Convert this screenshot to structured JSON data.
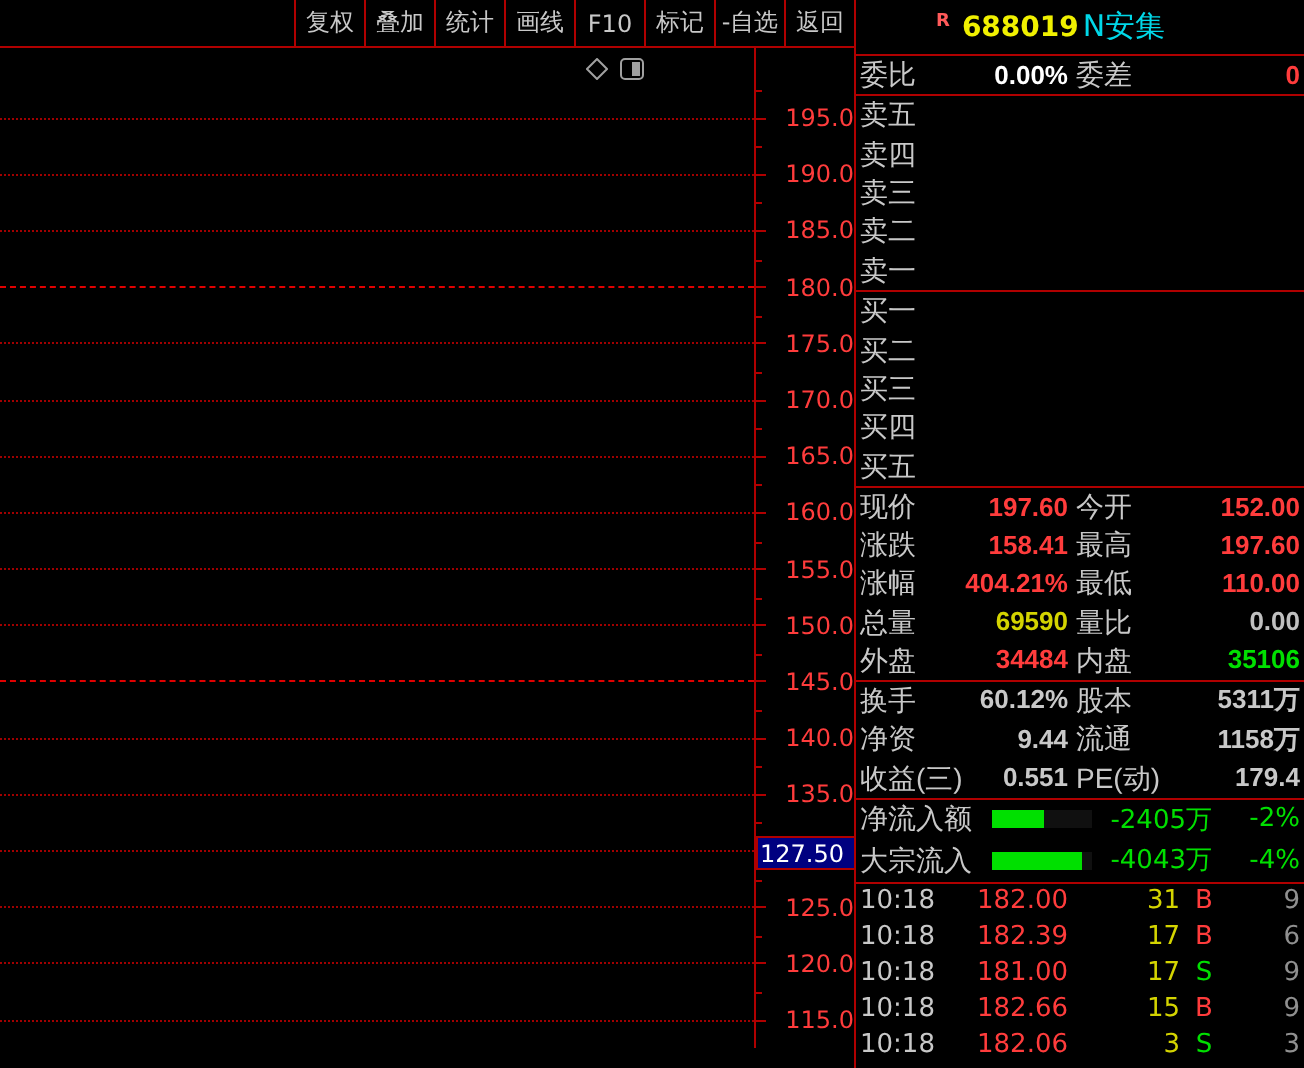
{
  "toolbar": {
    "buttons": [
      "复权",
      "叠加",
      "统计",
      "画线",
      "F10",
      "标记",
      "-自选",
      "返回"
    ]
  },
  "axis": [
    {
      "kind": "tick",
      "label": "195.0"
    },
    {
      "kind": "tick",
      "label": "190.0"
    },
    {
      "kind": "tick",
      "label": "185.0"
    },
    {
      "kind": "major",
      "label": "180.0"
    },
    {
      "kind": "tick",
      "label": "175.0"
    },
    {
      "kind": "tick",
      "label": "170.0"
    },
    {
      "kind": "tick",
      "label": "165.0"
    },
    {
      "kind": "tick",
      "label": "160.0"
    },
    {
      "kind": "tick",
      "label": "155.0"
    },
    {
      "kind": "tick",
      "label": "150.0"
    },
    {
      "kind": "major",
      "label": "145.0"
    },
    {
      "kind": "tick",
      "label": "140.0"
    },
    {
      "kind": "tick",
      "label": "135.0"
    },
    {
      "kind": "cursor",
      "label": "127.50"
    },
    {
      "kind": "tick",
      "label": "125.0"
    },
    {
      "kind": "tick",
      "label": "120.0"
    },
    {
      "kind": "tick",
      "label": "115.0"
    }
  ],
  "quote": {
    "badge": "R",
    "code": "688019",
    "name": "N安集"
  },
  "weibi": {
    "label": "委比",
    "value": "0.00%",
    "label2": "委差",
    "value2": "0"
  },
  "asks": [
    "卖五",
    "卖四",
    "卖三",
    "卖二",
    "卖一"
  ],
  "bids": [
    "买一",
    "买二",
    "买三",
    "买四",
    "买五"
  ],
  "stats": [
    {
      "label": "现价",
      "value": "197.60",
      "color": "#ff3c3c"
    },
    {
      "label": "今开",
      "value": "152.00",
      "color": "#ff3c3c"
    },
    {
      "label": "涨跌",
      "value": "158.41",
      "color": "#ff3c3c"
    },
    {
      "label": "最高",
      "value": "197.60",
      "color": "#ff3c3c"
    },
    {
      "label": "涨幅",
      "value": "404.21%",
      "color": "#ff3c3c"
    },
    {
      "label": "最低",
      "value": "110.00",
      "color": "#ff3c3c"
    },
    {
      "label": "总量",
      "value": "69590",
      "color": "#d4d400"
    },
    {
      "label": "量比",
      "value": "0.00",
      "color": "#c0c0c0"
    },
    {
      "label": "外盘",
      "value": "34484",
      "color": "#ff3c3c"
    },
    {
      "label": "内盘",
      "value": "35106",
      "color": "#00e000"
    }
  ],
  "fundamentals": [
    {
      "label": "换手",
      "value": "60.12%"
    },
    {
      "label": "股本",
      "value": "5311万"
    },
    {
      "label": "净资",
      "value": "9.44"
    },
    {
      "label": "流通",
      "value": "1158万"
    },
    {
      "label": "收益(三)",
      "value": "0.551"
    },
    {
      "label": "PE(动)",
      "value": "179.4"
    }
  ],
  "flows": [
    {
      "label": "净流入额",
      "level": 0.52,
      "amount": "-2405万",
      "pct": "-2%"
    },
    {
      "label": "大宗流入",
      "level": 0.9,
      "amount": "-4043万",
      "pct": "-4%"
    }
  ],
  "trades": [
    {
      "time": "10:18",
      "price": "182.00",
      "volume": "31",
      "side": "B",
      "color": "#ff3c3c",
      "count": "9"
    },
    {
      "time": "10:18",
      "price": "182.39",
      "volume": "17",
      "side": "B",
      "color": "#ff3c3c",
      "count": "6"
    },
    {
      "time": "10:18",
      "price": "181.00",
      "volume": "17",
      "side": "S",
      "color": "#00e000",
      "count": "9"
    },
    {
      "time": "10:18",
      "price": "182.66",
      "volume": "15",
      "side": "B",
      "color": "#ff3c3c",
      "count": "9"
    },
    {
      "time": "10:18",
      "price": "182.06",
      "volume": "3",
      "side": "S",
      "color": "#00e000",
      "count": "3"
    }
  ]
}
